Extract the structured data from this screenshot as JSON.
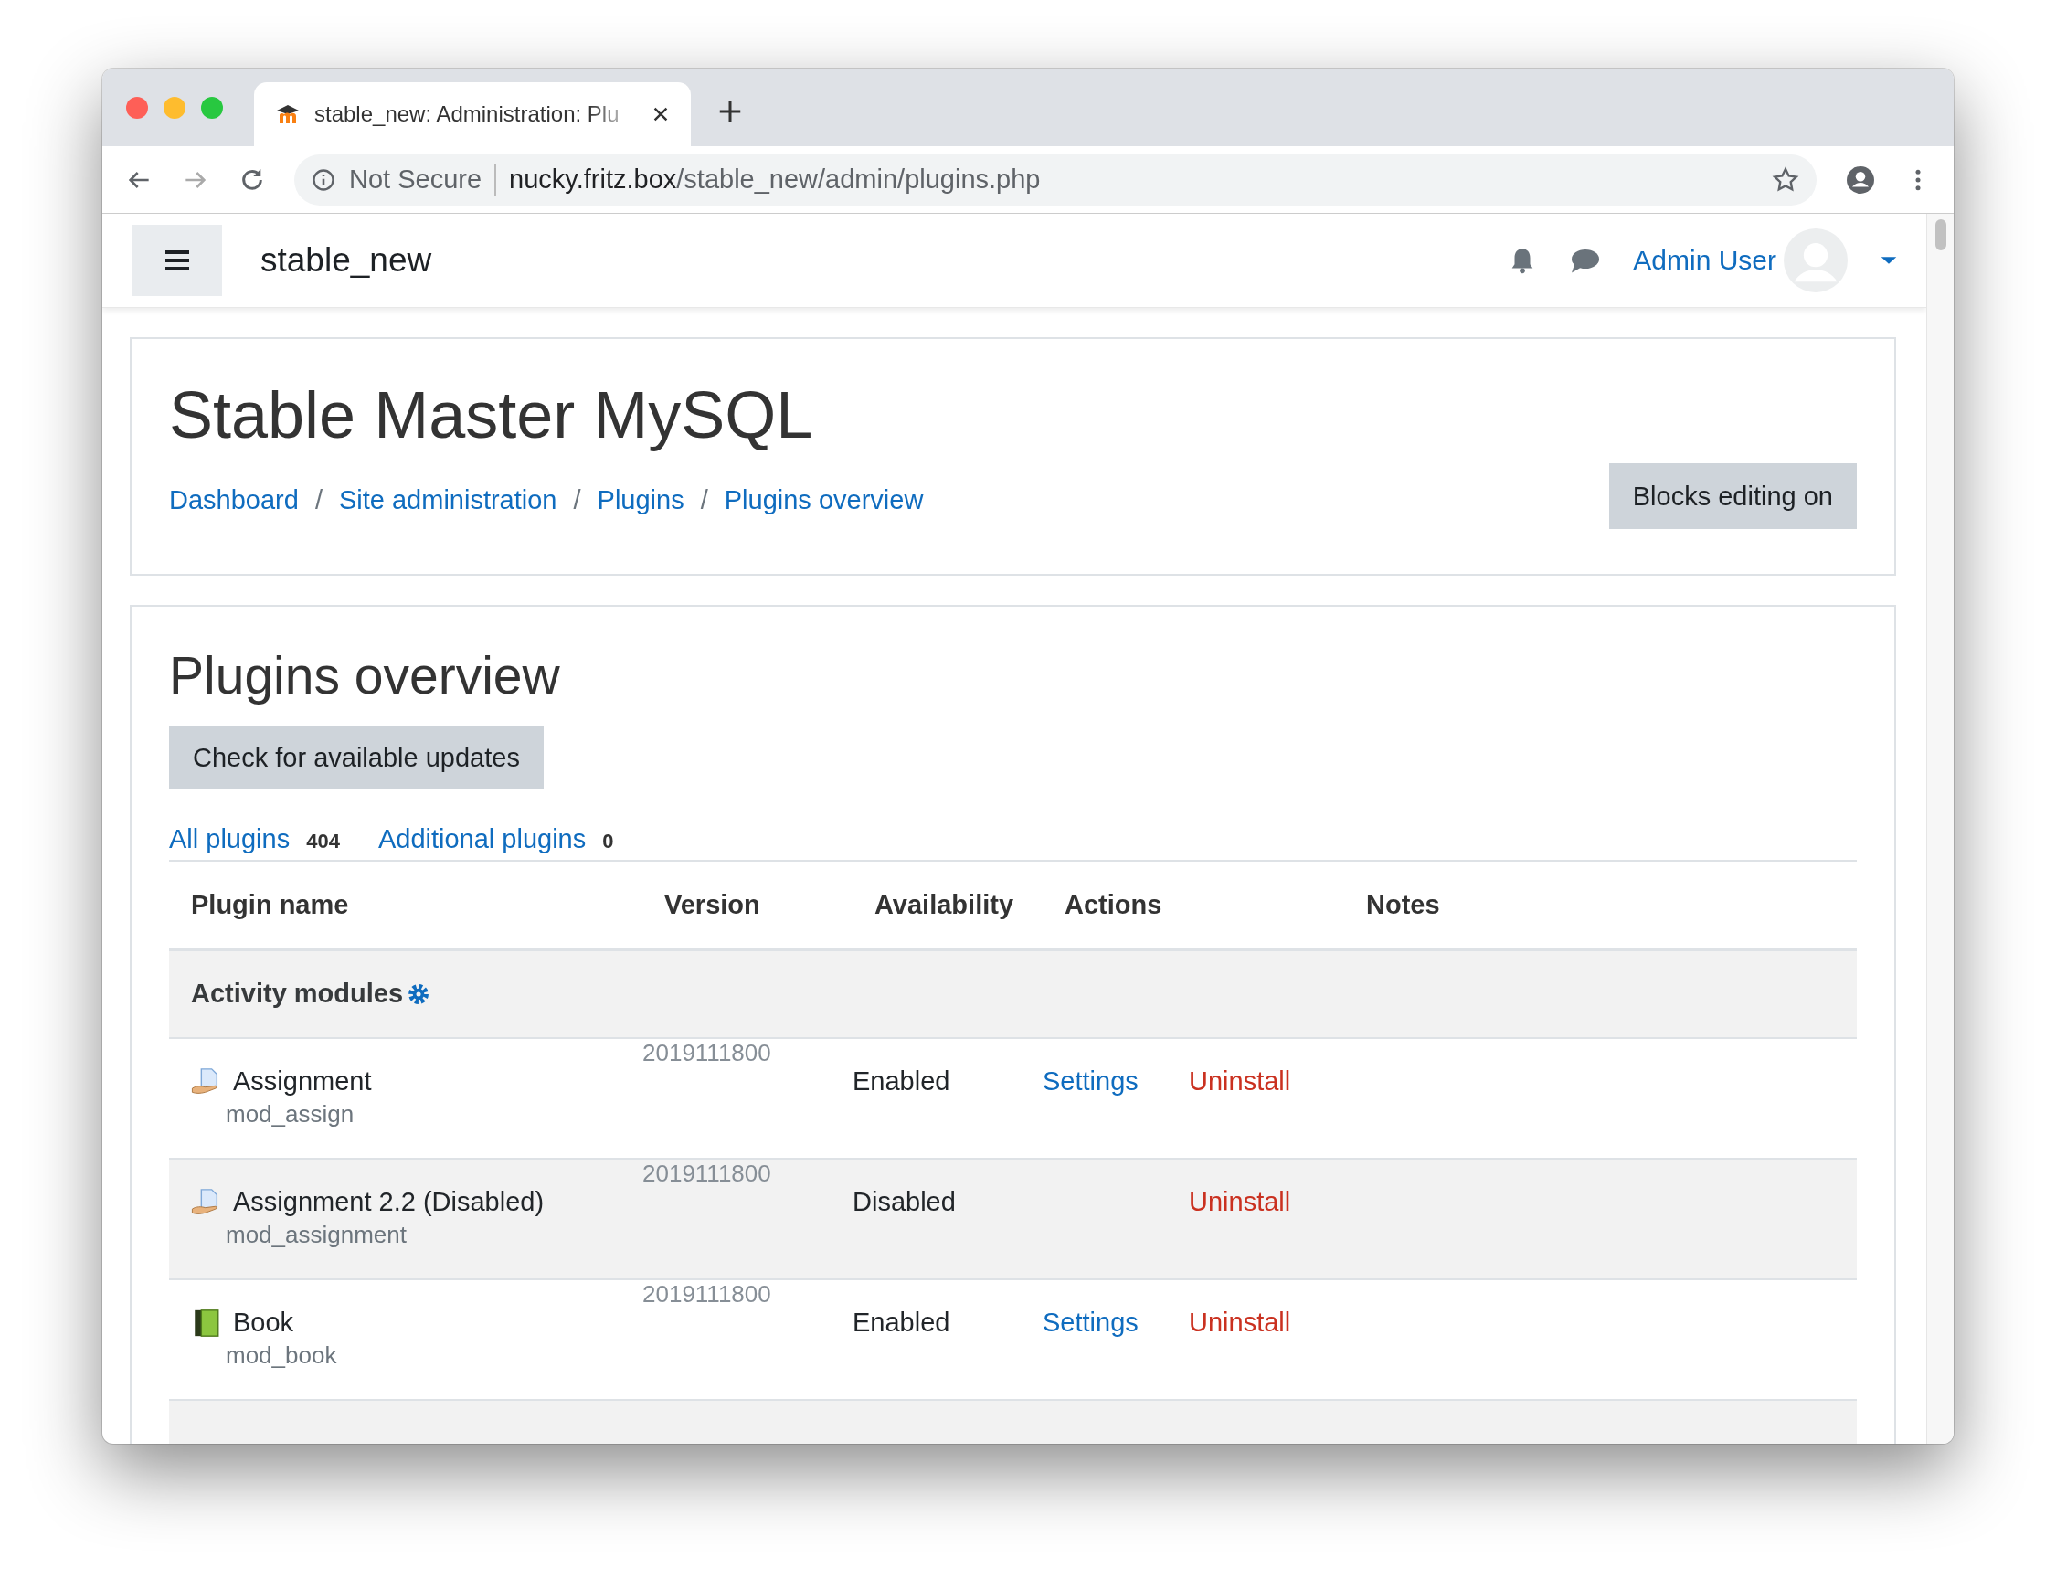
{
  "browser": {
    "tab_title": "stable_new: Administration: Plu",
    "security": "Not Secure",
    "url_host": "nucky.fritz.box",
    "url_path": "/stable_new/admin/plugins.php"
  },
  "navbar": {
    "site_name": "stable_new",
    "user_name": "Admin User"
  },
  "page_header": {
    "title": "Stable Master MySQL",
    "breadcrumbs": [
      {
        "label": "Dashboard",
        "separator": "/"
      },
      {
        "label": "Site administration",
        "separator": "/"
      },
      {
        "label": "Plugins",
        "separator": "/"
      },
      {
        "label": "Plugins overview"
      }
    ],
    "button": "Blocks editing on"
  },
  "main": {
    "heading": "Plugins overview",
    "button": "Check for available updates",
    "filters": [
      {
        "label": "All plugins",
        "count": "404"
      },
      {
        "label": "Additional plugins",
        "count": "0"
      }
    ],
    "table": {
      "columns": [
        "Plugin name",
        "Version",
        "Availability",
        "Actions",
        "Notes"
      ],
      "groups": [
        {
          "name": "Activity modules",
          "rows": [
            {
              "kind": "document",
              "name": "Assignment",
              "component": "mod_assign",
              "version": "2019111800",
              "availability": "Enabled",
              "settings": "Settings",
              "uninstall": "Uninstall"
            },
            {
              "kind": "document",
              "name": "Assignment 2.2 (Disabled)",
              "component": "mod_assignment",
              "version": "2019111800",
              "availability": "Disabled",
              "uninstall": "Uninstall"
            },
            {
              "kind": "book",
              "name": "Book",
              "component": "mod_book",
              "version": "2019111800",
              "availability": "Enabled",
              "settings": "Settings",
              "uninstall": "Uninstall"
            }
          ]
        }
      ]
    }
  }
}
